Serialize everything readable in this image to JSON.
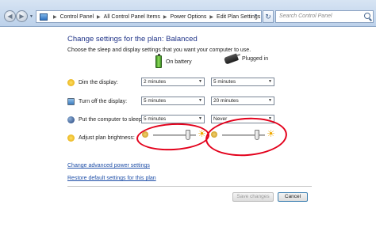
{
  "address_bar": {
    "crumbs": [
      "Control Panel",
      "All Control Panel Items",
      "Power Options",
      "Edit Plan Settings"
    ],
    "search_placeholder": "Search Control Panel",
    "refresh_glyph": "↻"
  },
  "page": {
    "title": "Change settings for the plan: Balanced",
    "subtitle": "Choose the sleep and display settings that you want your computer to use.",
    "columns": {
      "on_battery": "On battery",
      "plugged_in": "Plugged in"
    },
    "rows": {
      "dim": {
        "label": "Dim the display:",
        "battery": "2 minutes",
        "plugged": "5 minutes"
      },
      "off": {
        "label": "Turn off the display:",
        "battery": "5 minutes",
        "plugged": "20 minutes"
      },
      "sleep": {
        "label": "Put the computer to sleep:",
        "battery": "5 minutes",
        "plugged": "Never"
      },
      "brightness": {
        "label": "Adjust plan brightness:",
        "battery_level": 0.85,
        "plugged_level": 0.85
      }
    },
    "links": {
      "advanced": "Change advanced power settings",
      "restore": "Restore default settings for this plan"
    },
    "buttons": {
      "save": "Save changes",
      "cancel": "Cancel"
    }
  },
  "colors": {
    "title": "#1e3287",
    "link": "#1f4fa8",
    "annotation": "#e3001b"
  }
}
